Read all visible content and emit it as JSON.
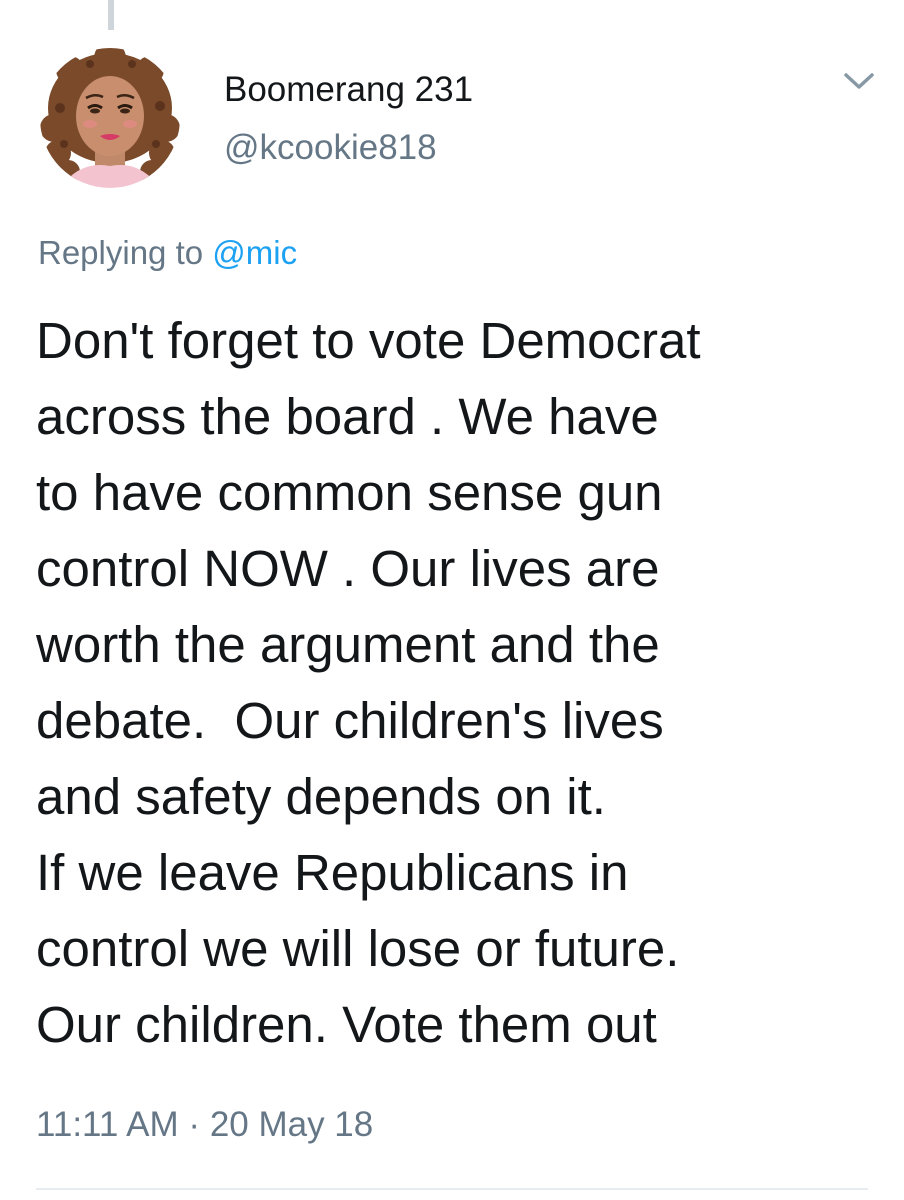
{
  "author": {
    "display_name": "Boomerang 231",
    "handle": "@kcookie818",
    "avatar_icon": "cartoon-woman-avatar"
  },
  "reply": {
    "prefix": "Replying to",
    "mention": "@mic"
  },
  "tweet": {
    "lines": [
      "Don't forget to vote Democrat",
      "across the board . We have",
      "to have common sense gun",
      "control NOW . Our lives are",
      "worth the argument and the",
      "debate.  Our children's lives",
      "and safety depends on it.",
      "If we leave Republicans in",
      "control we will lose or future.",
      "Our children. Vote them out"
    ]
  },
  "meta": {
    "time": "11:11 AM",
    "separator": "·",
    "date": "20 May 18"
  },
  "icons": {
    "more": "chevron-down-icon"
  },
  "colors": {
    "text": "#14171a",
    "secondary": "#657786",
    "link": "#1da1f2"
  }
}
